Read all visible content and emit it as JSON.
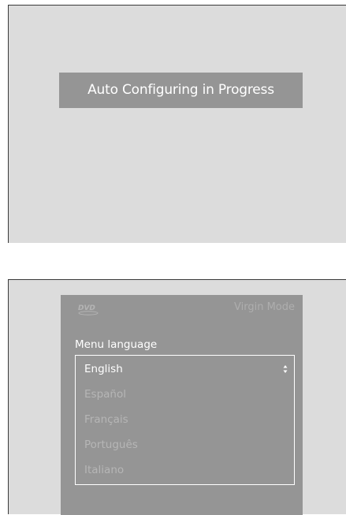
{
  "screen_top": {
    "banner_text": "Auto Configuring in Progress"
  },
  "screen_bottom": {
    "logo_icon": "dvd-logo-icon",
    "mode_label": "Virgin Mode",
    "menu_heading": "Menu language",
    "languages": [
      {
        "label": "English",
        "selected": true
      },
      {
        "label": "Español",
        "selected": false
      },
      {
        "label": "Français",
        "selected": false
      },
      {
        "label": "Português",
        "selected": false
      },
      {
        "label": "Italiano",
        "selected": false
      }
    ],
    "scroll_icon": "up-down-arrows-icon"
  },
  "colors": {
    "screen_bg": "#dcdcdc",
    "panel_bg": "#959595",
    "text_white": "#ffffff",
    "text_dim": "#b6b6b6"
  }
}
